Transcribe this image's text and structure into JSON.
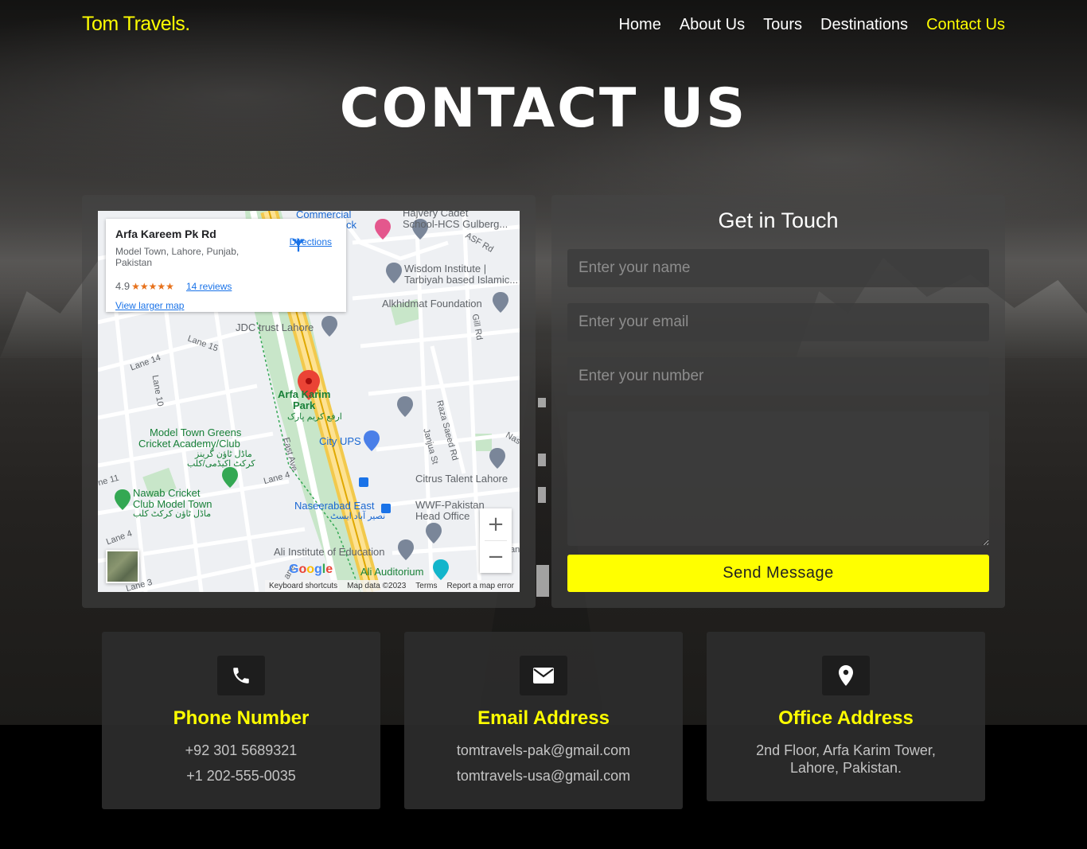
{
  "header": {
    "logo": "Tom Travels.",
    "nav": [
      {
        "label": "Home",
        "active": false
      },
      {
        "label": "About Us",
        "active": false
      },
      {
        "label": "Tours",
        "active": false
      },
      {
        "label": "Destinations",
        "active": false
      },
      {
        "label": "Contact Us",
        "active": true
      }
    ]
  },
  "hero": {
    "title": "CONTACT US"
  },
  "map": {
    "place_name": "Arfa Kareem Pk Rd",
    "address": "Model Town, Lahore, Punjab, Pakistan",
    "rating": "4.9",
    "stars": "★★★★★",
    "reviews": "14 reviews",
    "directions": "Directions",
    "larger_map": "View larger map",
    "footer": [
      "Keyboard shortcuts",
      "Map data ©2023",
      "Terms",
      "Report a map error"
    ],
    "zoom_in": "+",
    "zoom_out": "−",
    "labels": {
      "commercial": "Commercial",
      "ck": "ck",
      "hajvery": "Hajvery Cadet",
      "hcs": "School-HCS Gulberg...",
      "asf": "ASF Rd",
      "wisdom1": "Wisdom Institute |",
      "wisdom2": "Tarbiyah based Islamic...",
      "alkhidmat": "Alkhidmat Foundation",
      "jdc": "JDC trust Lahore",
      "gill": "Gill Rd",
      "lane15": "Lane 15",
      "lane14": "Lane 14",
      "lane10": "Lane 10",
      "arfa1": "Arfa Karim",
      "arfa2": "Park",
      "arfa_ur": "ارفع کریم پارک",
      "raza": "Raza Saeed Rd",
      "janjua": "Janjua St",
      "nas": "Nas",
      "mtg1": "Model Town Greens",
      "mtg2": "Cricket Academy/Club",
      "mtg_ur1": "ماڈل ٹاؤن گرینز",
      "mtg_ur2": "کرکٹ اکیڈمی/کلب",
      "cityups": "City UPS",
      "eastave": "East Ave",
      "citrus": "Citrus Talent Lahore",
      "lane11": "ne 11",
      "lane4": "Lane 4",
      "nawab1": "Nawab Cricket",
      "nawab2": "Club Model Town",
      "nawab_ur": "ماڈل ٹاؤن کرکٹ کلب",
      "naseerabad": "Naseerabad East",
      "naseerabad_ur": "نصیر آباد ایسٹ",
      "wwf1": "WWF-Pakistan",
      "wwf2": "Head Office",
      "lane4b": "Lane 4",
      "ali_inst": "Ali Institute of Education",
      "ali_aud": "Ali Auditorium",
      "lane3": "Lane 3",
      "ane": "ane",
      "an": "an"
    },
    "google": [
      "G",
      "o",
      "o",
      "g",
      "l",
      "e"
    ]
  },
  "form": {
    "title": "Get in Touch",
    "name_placeholder": "Enter your name",
    "email_placeholder": "Enter your email",
    "number_placeholder": "Enter your number",
    "message_value": "",
    "send_label": "Send Message"
  },
  "contact_cards": [
    {
      "icon": "phone-icon",
      "title": "Phone Number",
      "lines": [
        "+92 301 5689321",
        "+1 202-555-0035"
      ]
    },
    {
      "icon": "envelope-icon",
      "title": "Email Address",
      "lines": [
        "tomtravels-pak@gmail.com",
        "tomtravels-usa@gmail.com"
      ]
    },
    {
      "icon": "map-pin-icon",
      "title": "Office Address",
      "lines": [
        "2nd Floor, Arfa Karim Tower,",
        "Lahore, Pakistan."
      ]
    }
  ],
  "colors": {
    "accent": "#ffff00",
    "panel": "#464646",
    "background": "#000000"
  }
}
